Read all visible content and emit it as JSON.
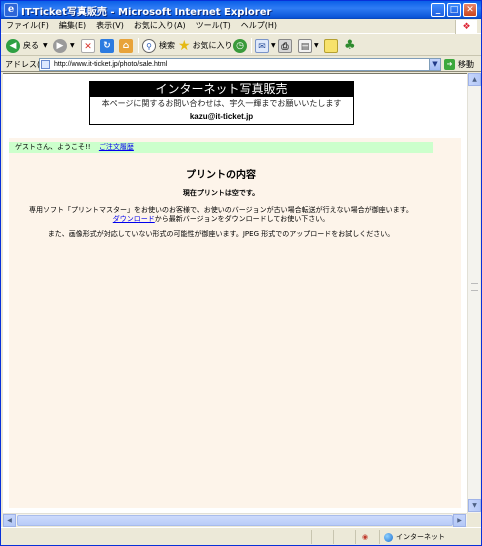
{
  "window": {
    "title": "IT-Ticket写真販売 - Microsoft Internet Explorer",
    "app_icon": "e",
    "controls": {
      "minimize": "_",
      "maximize": "□",
      "close": "✕"
    }
  },
  "menubar": {
    "items": [
      "ファイル(F)",
      "編集(E)",
      "表示(V)",
      "お気に入り(A)",
      "ツール(T)",
      "ヘルプ(H)"
    ]
  },
  "toolbar": {
    "back_label": "戻る",
    "search_label": "検索",
    "favorites_label": "お気に入り"
  },
  "addressbar": {
    "label": "アドレス(D)",
    "url": "http://www.it-ticket.jp/photo/sale.html",
    "go_label": "移動"
  },
  "page": {
    "header": {
      "title": "インターネット写真販売",
      "note": "本ページに関するお問い合わせは、宇久一輝までお願いいたします",
      "email": "kazu@it-ticket.jp"
    },
    "greeting": {
      "text": "ゲストさん、ようこそ!!",
      "link": "ご注文履歴"
    },
    "print_title": "プリントの内容",
    "empty_message": "現在プリントは空です。",
    "notice": {
      "line1": "専用ソフト「プリントマスター」をお使いのお客様で、お使いのバージョンが古い場合転送が行えない場合が御座います。",
      "download_link": "ダウンロード",
      "line2_rest": "から最新バージョンをダウンロードしてお使い下さい。"
    },
    "format_message": "また、画像形式が対応していない形式の可能性が御座います。JPEG 形式でのアップロードをお試しください。"
  },
  "statusbar": {
    "zone": "インターネット"
  },
  "colors": {
    "titlebar": "#0A5FE8",
    "greeting_bg": "#CCFFCC",
    "content_bg": "#FDF4EA",
    "link": "#0000EE"
  }
}
